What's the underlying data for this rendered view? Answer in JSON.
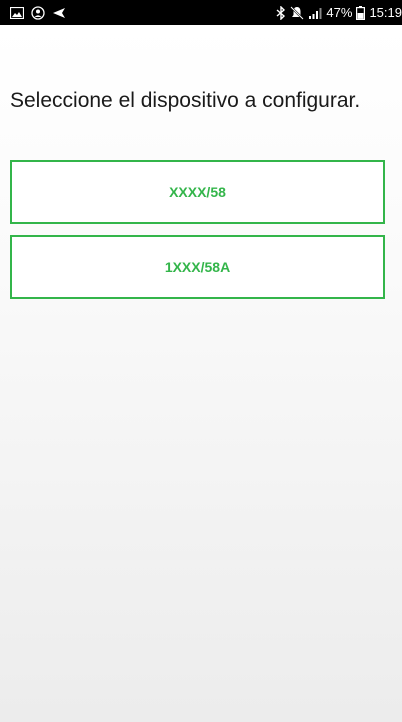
{
  "status_bar": {
    "battery": "47%",
    "time": "15:19",
    "icons": [
      "gallery-icon",
      "account-sync-icon",
      "send-icon",
      "bluetooth-icon",
      "mute-icon",
      "signal-icon",
      "battery-icon"
    ]
  },
  "screen": {
    "prompt": "Seleccione el dispositivo a configurar.",
    "devices": [
      {
        "label": "XXXX/58"
      },
      {
        "label": "1XXX/58A"
      }
    ]
  },
  "colors": {
    "accent": "#33b54a",
    "status_bar_bg": "#000000",
    "text": "#1a1a1a"
  }
}
